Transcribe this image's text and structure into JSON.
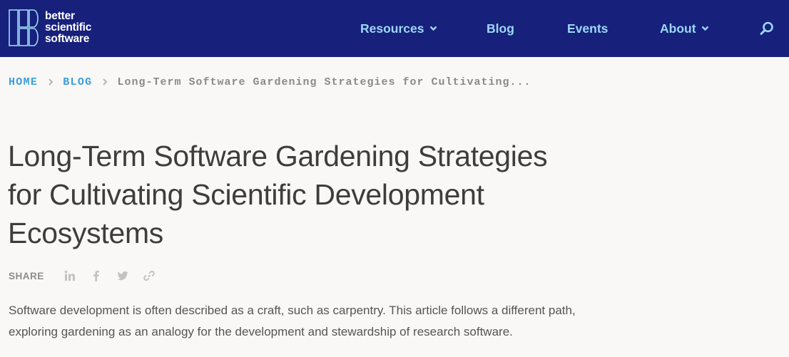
{
  "brand": {
    "line1": "better",
    "line2": "scientific",
    "line3": "software"
  },
  "nav": {
    "resources": "Resources",
    "blog": "Blog",
    "events": "Events",
    "about": "About"
  },
  "breadcrumb": {
    "home": "HOME",
    "blog": "BLOG",
    "current": "Long-Term Software Gardening Strategies for Cultivating..."
  },
  "article": {
    "title": "Long-Term Software Gardening Strategies for Cultivating Scientific Development Ecosystems",
    "share_label": "SHARE",
    "intro": "Software development is often described as a craft, such as carpentry. This article follows a different path, exploring gardening as an analogy for the development and stewardship of research software."
  },
  "icons": {
    "nav_chevron": "chevron-down-icon",
    "search": "search-icon",
    "breadcrumb_sep": "chevron-right-icon",
    "share": [
      "linkedin-icon",
      "facebook-icon",
      "twitter-icon",
      "link-icon"
    ]
  },
  "colors": {
    "header_bg": "#17207a",
    "nav_text": "#9bd8f6",
    "breadcrumb_link": "#3b9fdc",
    "page_bg": "#f9f8f6"
  }
}
